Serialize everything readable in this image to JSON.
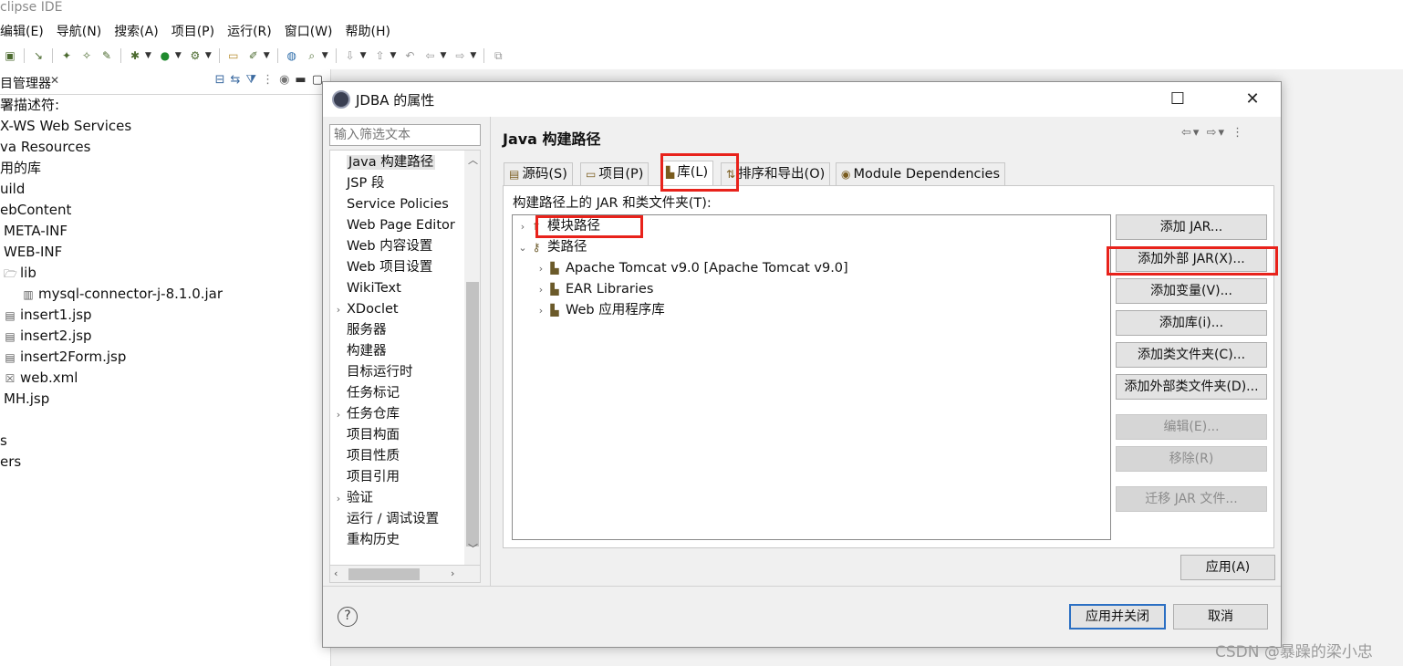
{
  "ide": {
    "title": "clipse IDE",
    "menu": [
      "编辑(E)",
      "导航(N)",
      "搜索(A)",
      "项目(P)",
      "运行(R)",
      "窗口(W)",
      "帮助(H)"
    ]
  },
  "explorer": {
    "tab_label": "目管理器",
    "close_glyph": "✕",
    "tree": [
      {
        "label": "署描述符:",
        "indent": 0
      },
      {
        "label": "X-WS Web Services",
        "indent": 0
      },
      {
        "label": "va Resources",
        "indent": 0
      },
      {
        "label": "用的库",
        "indent": 0
      },
      {
        "label": "uild",
        "indent": 0
      },
      {
        "label": "ebContent",
        "indent": 0
      },
      {
        "label": "META-INF",
        "indent": 4
      },
      {
        "label": "WEB-INF",
        "indent": 4
      },
      {
        "label": "lib",
        "indent": 4,
        "icon": "folder-icon"
      },
      {
        "label": "mysql-connector-j-8.1.0.jar",
        "indent": 24,
        "icon": "jar-icon"
      },
      {
        "label": "insert1.jsp",
        "indent": 4,
        "icon": "jsp-file-icon"
      },
      {
        "label": "insert2.jsp",
        "indent": 4,
        "icon": "jsp-file-icon"
      },
      {
        "label": "insert2Form.jsp",
        "indent": 4,
        "icon": "jsp-file-icon"
      },
      {
        "label": "web.xml",
        "indent": 4,
        "icon": "xml-file-icon"
      },
      {
        "label": "MH.jsp",
        "indent": 4
      },
      {
        "label": "",
        "indent": 0
      },
      {
        "label": "s",
        "indent": 0
      },
      {
        "label": "ers",
        "indent": 0
      }
    ]
  },
  "dialog": {
    "title": "JDBA 的属性",
    "filter_placeholder": "输入筛选文本",
    "nav_items": [
      {
        "label": "Java 构建路径",
        "expandable": false,
        "selected": true
      },
      {
        "label": "JSP 段",
        "expandable": false
      },
      {
        "label": "Service Policies",
        "expandable": false
      },
      {
        "label": "Web Page Editor",
        "expandable": false
      },
      {
        "label": "Web 内容设置",
        "expandable": false
      },
      {
        "label": "Web 项目设置",
        "expandable": false
      },
      {
        "label": "WikiText",
        "expandable": false
      },
      {
        "label": "XDoclet",
        "expandable": true
      },
      {
        "label": "服务器",
        "expandable": false
      },
      {
        "label": "构建器",
        "expandable": false
      },
      {
        "label": "目标运行时",
        "expandable": false
      },
      {
        "label": "任务标记",
        "expandable": false
      },
      {
        "label": "任务仓库",
        "expandable": true
      },
      {
        "label": "项目构面",
        "expandable": false
      },
      {
        "label": "项目性质",
        "expandable": false
      },
      {
        "label": "项目引用",
        "expandable": false
      },
      {
        "label": "验证",
        "expandable": true
      },
      {
        "label": "运行 / 调试设置",
        "expandable": false
      },
      {
        "label": "重构历史",
        "expandable": false
      }
    ],
    "page_title": "Java 构建路径",
    "tabs": [
      {
        "label": "源码(S)",
        "active": false
      },
      {
        "label": "项目(P)",
        "active": false
      },
      {
        "label": "库(L)",
        "active": true
      },
      {
        "label": "排序和导出(O)",
        "active": false
      },
      {
        "label": "Module Dependencies",
        "active": false
      }
    ],
    "classpath_label": "构建路径上的 JAR 和类文件夹(T):",
    "tree": [
      {
        "label": "模块路径",
        "level": 0,
        "expanded": false
      },
      {
        "label": "类路径",
        "level": 0,
        "expanded": true
      },
      {
        "label": "Apache Tomcat v9.0 [Apache Tomcat v9.0]",
        "level": 1,
        "expanded": false
      },
      {
        "label": "EAR Libraries",
        "level": 1,
        "expanded": false
      },
      {
        "label": "Web 应用程序库",
        "level": 1,
        "expanded": false
      }
    ],
    "buttons": [
      {
        "label": "添加 JAR...",
        "enabled": true
      },
      {
        "label": "添加外部 JAR(X)...",
        "enabled": true
      },
      {
        "label": "添加变量(V)...",
        "enabled": true
      },
      {
        "label": "添加库(i)...",
        "enabled": true
      },
      {
        "label": "添加类文件夹(C)...",
        "enabled": true
      },
      {
        "label": "添加外部类文件夹(D)...",
        "enabled": true
      },
      {
        "label": "编辑(E)...",
        "enabled": false
      },
      {
        "label": "移除(R)",
        "enabled": false
      },
      {
        "label": "迁移 JAR 文件...",
        "enabled": false
      }
    ],
    "apply_label": "应用(A)",
    "apply_close_label": "应用并关闭",
    "cancel_label": "取消",
    "help_glyph": "?"
  },
  "watermark": "CSDN @暴躁的梁小忠",
  "colors": {
    "highlight_box": "#e8221b",
    "default_button_border": "#2b6fc3"
  }
}
